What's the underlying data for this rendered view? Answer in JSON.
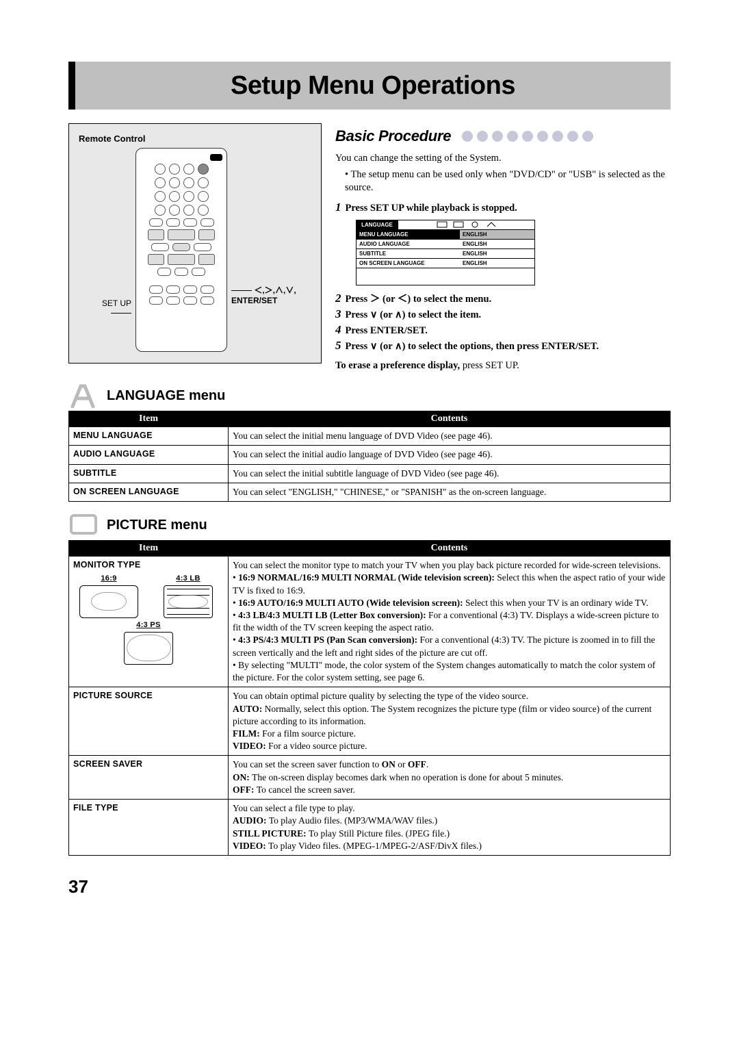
{
  "title": "Setup Menu Operations",
  "page_number": "37",
  "remote": {
    "label": "Remote Control",
    "callout_left": "SET UP",
    "callout_right": "＜,＞,∧,∨,\nENTER/SET"
  },
  "basic": {
    "heading": "Basic Procedure",
    "intro": "You can change the setting of the System.",
    "bullet": "The setup menu can be used only when \"DVD/CD\" or \"USB\" is selected as the source.",
    "steps": [
      "Press SET UP while playback is stopped.",
      "Press ＞ (or ＜) to select the menu.",
      "Press ∨ (or ∧) to select the item.",
      "Press ENTER/SET.",
      "Press ∨ (or ∧) to select the options, then press ENTER/SET."
    ],
    "erase_lead": "To erase a preference display, ",
    "erase_rest": "press SET UP."
  },
  "osd": {
    "tab": "LANGUAGE",
    "rows": [
      {
        "l": "MENU LANGUAGE",
        "r": "ENGLISH"
      },
      {
        "l": "AUDIO LANGUAGE",
        "r": "ENGLISH"
      },
      {
        "l": "SUBTITLE",
        "r": "ENGLISH"
      },
      {
        "l": "ON SCREEN LANGUAGE",
        "r": "ENGLISH"
      }
    ]
  },
  "lang_menu": {
    "heading": "LANGUAGE menu",
    "col_item": "Item",
    "col_contents": "Contents",
    "rows": [
      {
        "item": "MENU LANGUAGE",
        "contents": "You can select the initial menu language of DVD Video (see page 46)."
      },
      {
        "item": "AUDIO LANGUAGE",
        "contents": "You can select the initial audio language of DVD Video (see page 46)."
      },
      {
        "item": "SUBTITLE",
        "contents": "You can select the initial subtitle language of DVD Video (see page 46)."
      },
      {
        "item": "ON SCREEN LANGUAGE",
        "contents": "You can select \"ENGLISH,\" \"CHINESE,\" or \"SPANISH\" as the on-screen language."
      }
    ]
  },
  "pic_menu": {
    "heading": "PICTURE menu",
    "col_item": "Item",
    "col_contents": "Contents",
    "monitor": {
      "item": "MONITOR TYPE",
      "label_169": "16:9",
      "label_43lb": "4:3 LB",
      "label_43ps": "4:3 PS",
      "intro": "You can select the monitor type to match your TV when you play back picture recorded for wide-screen televisions.",
      "b1_lead": "16:9 NORMAL/16:9 MULTI NORMAL (Wide television screen): ",
      "b1_rest": "Select this when the aspect ratio of your wide TV is fixed to 16:9.",
      "b2_lead": "16:9 AUTO/16:9 MULTI AUTO (Wide television screen): ",
      "b2_rest": "Select this when your TV is an ordinary wide TV.",
      "b3_lead": "4:3 LB/4:3 MULTI LB (Letter Box conversion): ",
      "b3_rest": "For a conventional (4:3) TV. Displays a wide-screen picture to fit the width of the TV screen keeping the aspect ratio.",
      "b4_lead": "4:3 PS/4:3 MULTI PS (Pan Scan conversion): ",
      "b4_rest": "For a conventional (4:3) TV. The picture is zoomed in to fill the screen vertically and the left and right sides of the picture are cut off.",
      "b5": "By selecting \"MULTI\" mode, the color system of the System changes automatically to match the color system of the picture. For the color system setting, see page 6."
    },
    "picture_source": {
      "item": "PICTURE SOURCE",
      "l1": "You can obtain optimal picture quality by selecting the type of the video source.",
      "l2_lead": "AUTO: ",
      "l2_rest": "Normally, select this option. The System recognizes the picture type (film or video source) of the current picture according to its information.",
      "l3_lead": "FILM: ",
      "l3_rest": "For a film source picture.",
      "l4_lead": "VIDEO: ",
      "l4_rest": "For a video source picture."
    },
    "screen_saver": {
      "item": "SCREEN SAVER",
      "l1_a": "You can set the screen saver function to ",
      "l1_on": "ON",
      "l1_or": " or ",
      "l1_off": "OFF",
      "l1_end": ".",
      "l2_lead": "ON: ",
      "l2_rest": "The on-screen display becomes dark when no operation is done for about 5 minutes.",
      "l3_lead": "OFF: ",
      "l3_rest": "To cancel the screen saver."
    },
    "file_type": {
      "item": "FILE TYPE",
      "l1": "You can select a file type to play.",
      "l2_lead": "AUDIO: ",
      "l2_rest": "To play Audio files. (MP3/WMA/WAV files.)",
      "l3_lead": "STILL PICTURE: ",
      "l3_rest": "To play Still Picture files. (JPEG file.)",
      "l4_lead": "VIDEO: ",
      "l4_rest": "To play Video files. (MPEG-1/MPEG-2/ASF/DivX files.)"
    }
  }
}
